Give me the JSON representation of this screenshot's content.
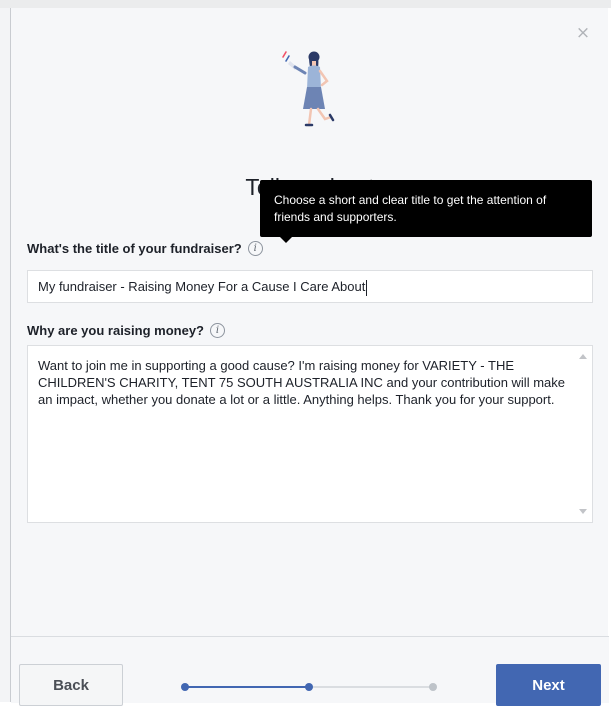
{
  "dialog": {
    "heading": "Tell us about",
    "close_label": "×"
  },
  "tooltip": {
    "text": "Choose a short and clear title to get the attention of friends and supporters."
  },
  "title_field": {
    "label": "What's the title of your fundraiser?",
    "value": "My fundraiser - Raising Money For a Cause I Care About",
    "info_icon": "info-icon"
  },
  "description_field": {
    "label": "Why are you raising money?",
    "value": "Want to join me in supporting a good cause? I'm raising money for VARIETY - THE CHILDREN'S CHARITY, TENT 75 SOUTH AUSTRALIA INC and your contribution will make an impact, whether you donate a lot or a little. Anything helps. Thank you for your support.",
    "info_icon": "info-icon"
  },
  "footer": {
    "back_label": "Back",
    "next_label": "Next",
    "progress": {
      "total_steps": 3,
      "current_step": 2
    }
  },
  "colors": {
    "primary": "#4267b2",
    "inactive": "#bec3c9",
    "tooltip_bg": "#000000",
    "text": "#1d2129"
  }
}
